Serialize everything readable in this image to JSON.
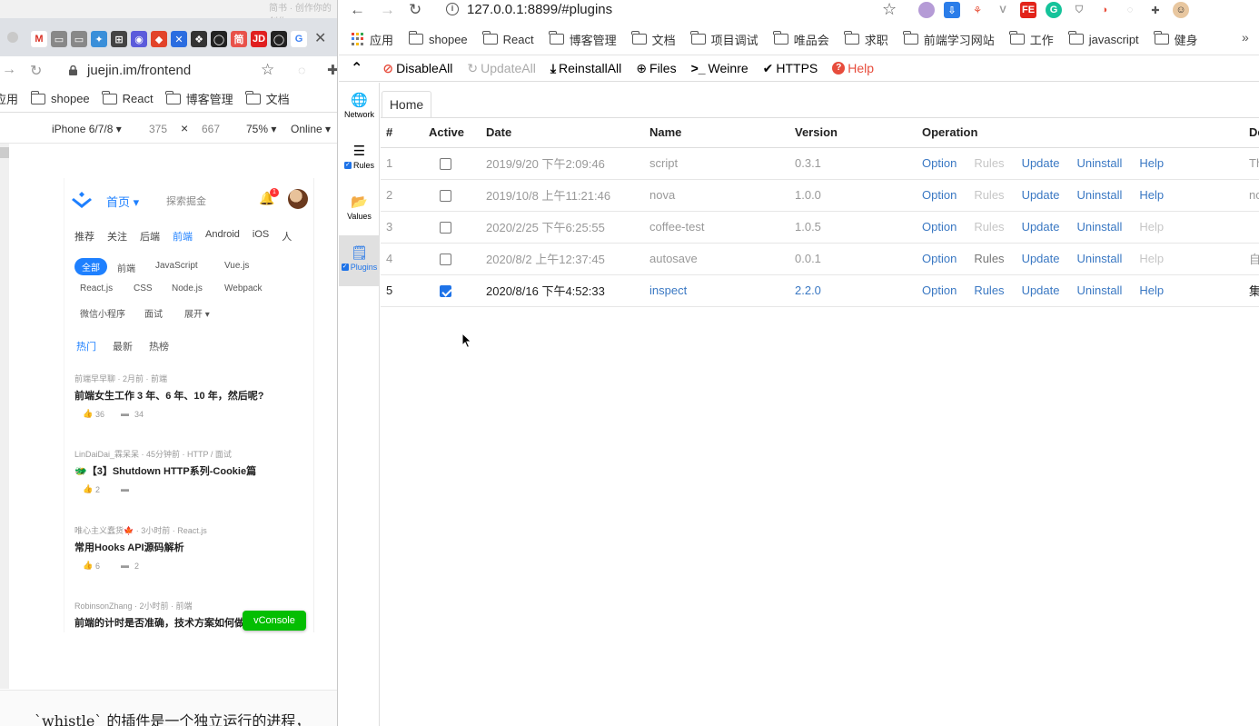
{
  "left_browser": {
    "ghost_title": "简书 · 创作你的创作",
    "tab_favicons": [
      "M",
      "▭",
      "▭",
      "✦",
      "⊞",
      "◉",
      "◆",
      "✕",
      "❖",
      "◯",
      "简",
      "JD",
      "◯",
      "G"
    ],
    "url": "juejin.im/frontend",
    "bookmarks": [
      "应用",
      "shopee",
      "React",
      "博客管理",
      "文档"
    ],
    "device": {
      "name": "iPhone 6/7/8 ▾",
      "width": "375",
      "times": "×",
      "height": "667",
      "zoom": "75% ▾",
      "network": "Online ▾"
    },
    "mobile": {
      "home_label": "首页 ▾",
      "search_placeholder": "探索掘金",
      "badge": "1",
      "nav": [
        "推荐",
        "关注",
        "后端",
        "前端",
        "Android",
        "iOS",
        "人"
      ],
      "tag_active": "全部",
      "tags_row1": [
        "前端",
        "JavaScript",
        "Vue.js"
      ],
      "tags_row2": [
        "React.js",
        "CSS",
        "Node.js",
        "Webpack"
      ],
      "tags_row3": [
        "微信小程序",
        "面试",
        "展开 ▾"
      ],
      "tabs": [
        "热门",
        "最新",
        "热榜"
      ],
      "articles": [
        {
          "meta": "前端早早聊 · 2月前 · 前端",
          "title": "前端女生工作 3 年、6 年、10 年，然后呢?",
          "likes": "36",
          "comments": "34"
        },
        {
          "meta": "LinDaiDai_霖呆呆 · 45分钟前 · HTTP / 面试",
          "title": "🐲【3】Shutdown HTTP系列-Cookie篇",
          "likes": "2",
          "comments": ""
        },
        {
          "meta": "唯心主义蠢货🍁 · 3小时前 · React.js",
          "title": "常用Hooks API源码解析",
          "likes": "6",
          "comments": "2"
        },
        {
          "meta": "RobinsonZhang · 2小时前 · 前端",
          "title": "前端的计时是否准确，技术方案如何做",
          "likes": "",
          "comments": ""
        }
      ],
      "vconsole": "vConsole"
    },
    "footer_text": "`whistle` 的插件是一个独立运行的进程，"
  },
  "right_browser": {
    "url": "127.0.0.1:8899/#plugins",
    "extension_icons": [
      "●",
      "⇩",
      "⚘",
      "V",
      "FE",
      "G",
      "⛉",
      "◑",
      "◌",
      "✚",
      "☺"
    ],
    "bookmarks": [
      "应用",
      "shopee",
      "React",
      "博客管理",
      "文档",
      "项目调试",
      "唯品会",
      "求职",
      "前端学习网站",
      "工作",
      "javascript",
      "健身"
    ],
    "toolbar": {
      "collapse": "⌃",
      "disable_all": "DisableAll",
      "update_all": "UpdateAll",
      "reinstall_all": "ReinstallAll",
      "files": "Files",
      "weinre": "Weinre",
      "https": "HTTPS",
      "help": "Help"
    },
    "sidebar": [
      {
        "label": "Network",
        "icon": "globe-icon",
        "checkbox": false,
        "active": false
      },
      {
        "label": "Rules",
        "icon": "list-icon",
        "checkbox": true,
        "active": false
      },
      {
        "label": "Values",
        "icon": "folder-icon",
        "checkbox": false,
        "active": false
      },
      {
        "label": "Plugins",
        "icon": "document-icon",
        "checkbox": true,
        "active": true
      }
    ],
    "home_tab": "Home",
    "table": {
      "headers": [
        "#",
        "Active",
        "Date",
        "Name",
        "Version",
        "Operation",
        "De"
      ],
      "rows": [
        {
          "num": "1",
          "active": false,
          "date": "2019/9/20 下午2:09:46",
          "name": "script",
          "version": "0.3.1",
          "rules_enabled": false,
          "help_enabled": true,
          "desc": "Th"
        },
        {
          "num": "2",
          "active": false,
          "date": "2019/10/8 上午11:21:46",
          "name": "nova",
          "version": "1.0.0",
          "rules_enabled": false,
          "help_enabled": true,
          "desc": "nc"
        },
        {
          "num": "3",
          "active": false,
          "date": "2020/2/25 下午6:25:55",
          "name": "coffee-test",
          "version": "1.0.5",
          "rules_enabled": false,
          "help_enabled": false,
          "desc": ""
        },
        {
          "num": "4",
          "active": false,
          "date": "2020/8/2 上午12:37:45",
          "name": "autosave",
          "version": "0.0.1",
          "rules_enabled": true,
          "help_enabled": false,
          "desc": "自"
        },
        {
          "num": "5",
          "active": true,
          "date": "2020/8/16 下午4:52:33",
          "name": "inspect",
          "version": "2.2.0",
          "rules_enabled": true,
          "help_enabled": true,
          "desc": "集"
        }
      ],
      "ops": [
        "Option",
        "Rules",
        "Update",
        "Uninstall",
        "Help"
      ]
    }
  }
}
